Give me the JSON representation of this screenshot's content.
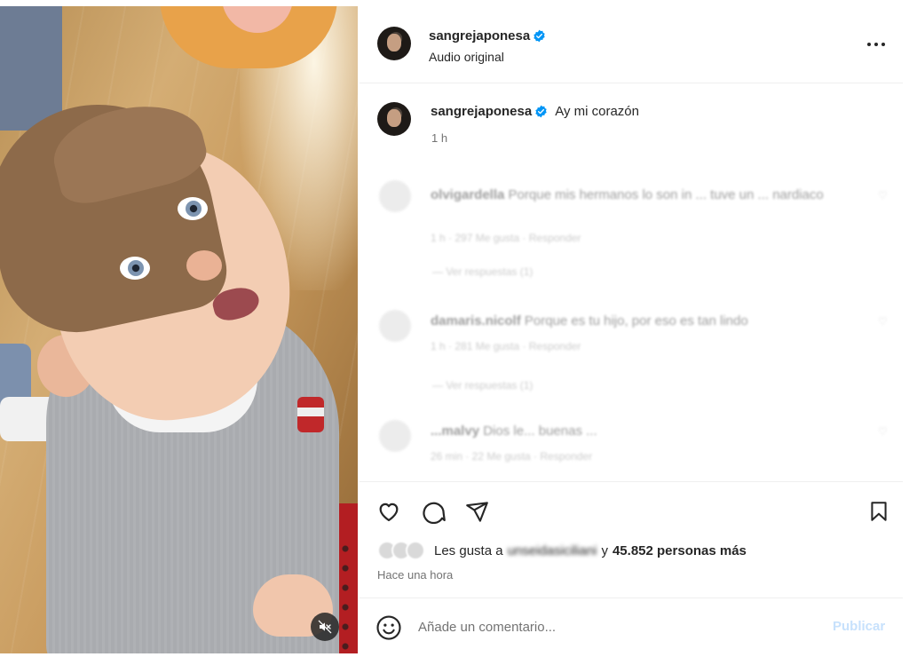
{
  "post": {
    "username": "sangrejaponesa",
    "audio_label": "Audio original",
    "caption": "Ay mi corazón",
    "caption_time": "1 h"
  },
  "comments": [
    {
      "username": "olvigardella",
      "text": "Porque mis hermanos lo son in ... tuve un ... nardiaco",
      "meta": "1 h · 297 Me gusta · Responder",
      "replies": "— Ver respuestas (1)"
    },
    {
      "username": "damaris.nicolf",
      "text": "Porque es tu hijo, por eso es tan lindo",
      "meta": "1 h · 281 Me gusta · Responder",
      "replies": "— Ver respuestas (1)"
    },
    {
      "username": "...malvy",
      "text": "Dios le... buenas ...",
      "meta": "26 min · 22 Me gusta · Responder",
      "replies": ""
    }
  ],
  "likes": {
    "prefix": "Les gusta a",
    "user": "unseidasiciliani",
    "connector": "y",
    "count": "45.852 personas más"
  },
  "time_ago": "Hace una hora",
  "composer": {
    "placeholder": "Añade un comentario...",
    "publish_label": "Publicar"
  },
  "icons": {
    "verified": "verified-badge-icon",
    "more": "more-options-icon",
    "like": "heart-icon",
    "comment": "comment-bubble-icon",
    "share": "paper-plane-icon",
    "save": "bookmark-icon",
    "emoji": "emoji-smiley-icon",
    "mute": "speaker-muted-icon"
  },
  "colors": {
    "verified": "#0095f6",
    "publish_disabled": "#c7e1fc",
    "secondary_text": "#737373"
  }
}
